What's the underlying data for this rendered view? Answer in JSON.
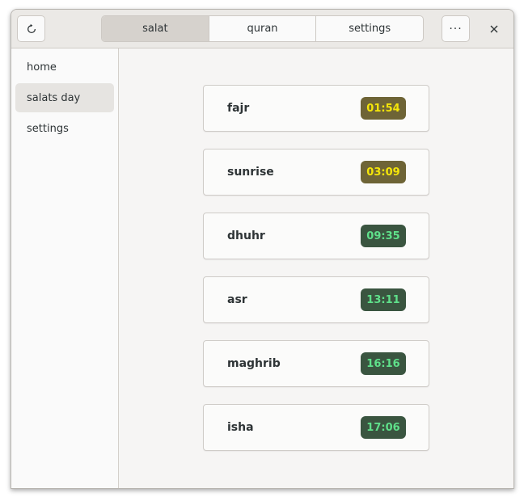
{
  "header": {
    "refresh_icon": "refresh-icon",
    "tabs": [
      {
        "label": "salat",
        "active": true
      },
      {
        "label": "quran",
        "active": false
      },
      {
        "label": "settings",
        "active": false
      }
    ],
    "menu_label": "···",
    "close_label": "✕"
  },
  "sidebar": {
    "items": [
      {
        "label": "home",
        "selected": false
      },
      {
        "label": "salats day",
        "selected": true
      },
      {
        "label": "settings",
        "selected": false
      }
    ]
  },
  "prayers": [
    {
      "name": "fajr",
      "time": "01:54",
      "status": "passed"
    },
    {
      "name": "sunrise",
      "time": "03:09",
      "status": "passed"
    },
    {
      "name": "dhuhr",
      "time": "09:35",
      "status": "upcoming"
    },
    {
      "name": "asr",
      "time": "13:11",
      "status": "upcoming"
    },
    {
      "name": "maghrib",
      "time": "16:16",
      "status": "upcoming"
    },
    {
      "name": "isha",
      "time": "17:06",
      "status": "upcoming"
    }
  ],
  "colors": {
    "passed_badge_bg": "#6e6436",
    "passed_badge_text": "#f5e60a",
    "upcoming_badge_bg": "#3a5540",
    "upcoming_badge_text": "#5fe08a"
  }
}
